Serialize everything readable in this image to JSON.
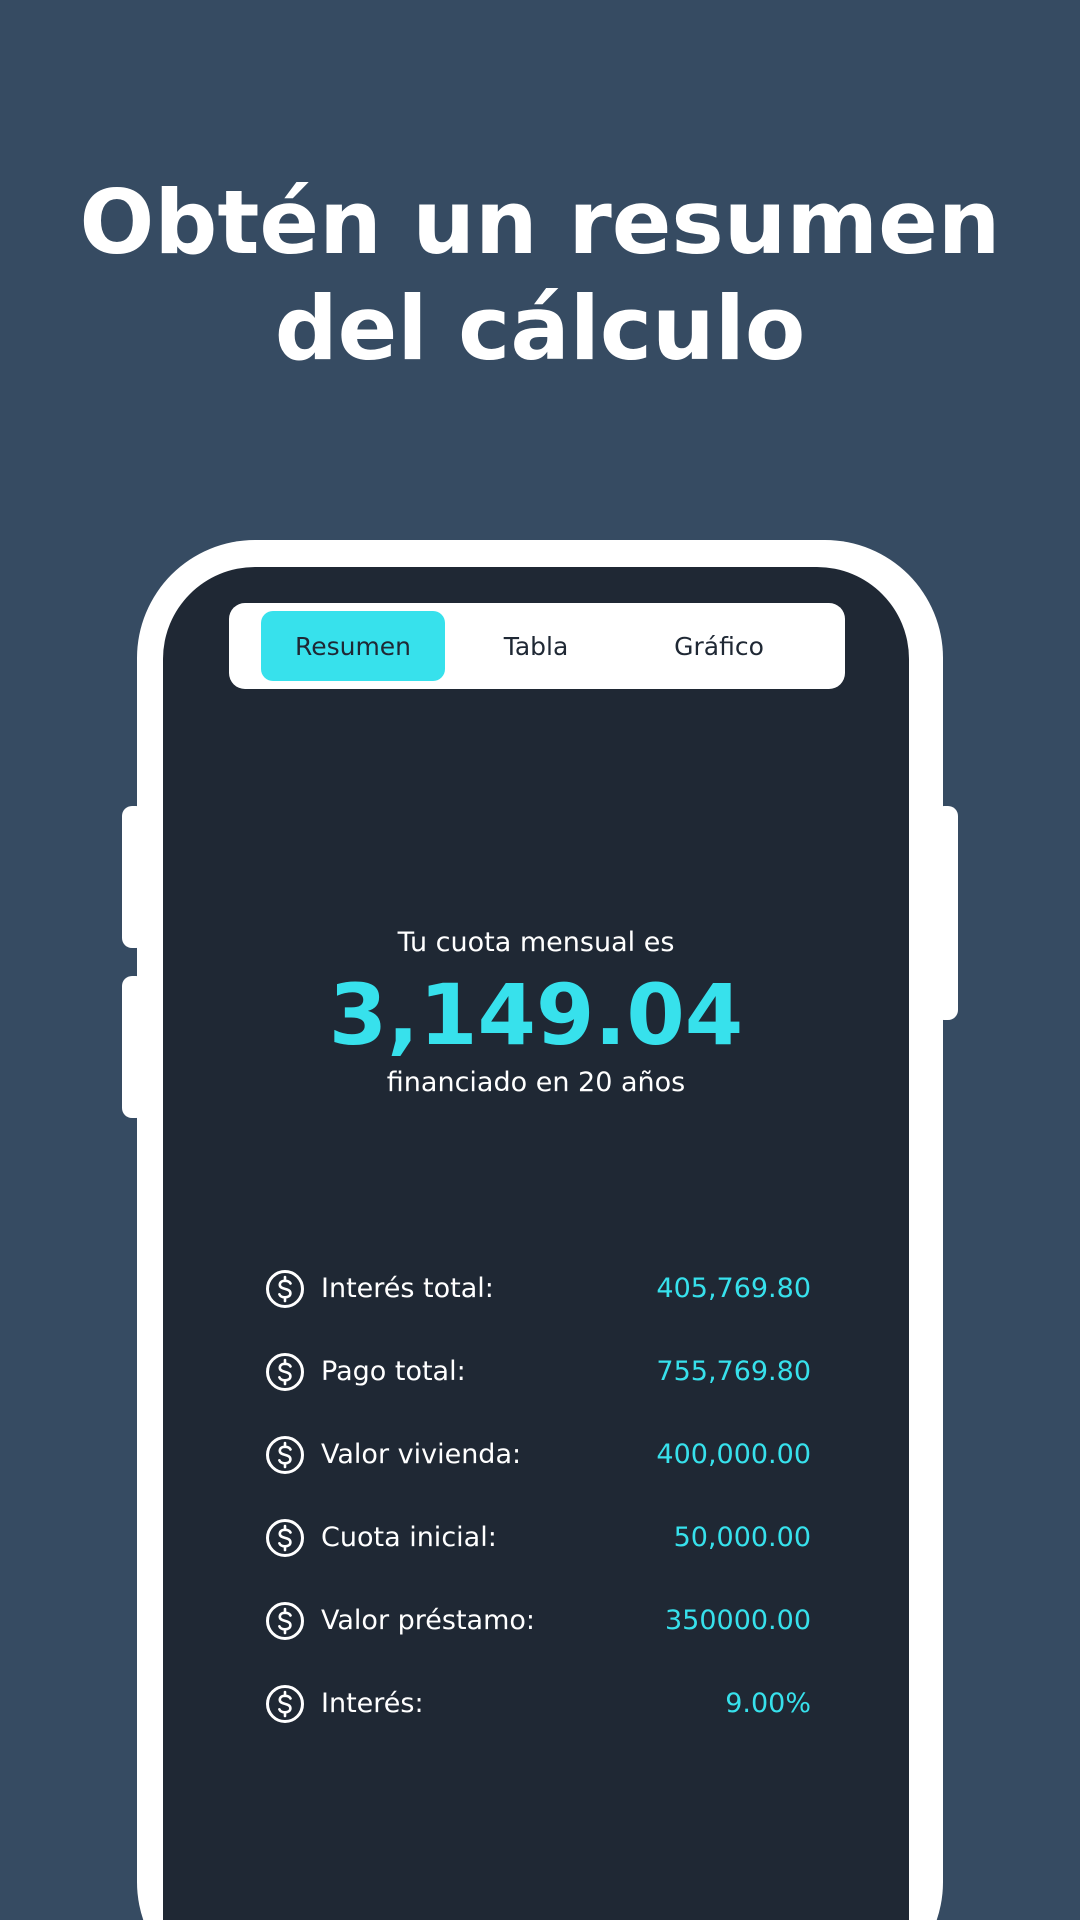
{
  "headline": {
    "line1": "Obtén un resumen",
    "line2": "del cálculo"
  },
  "tabs": [
    {
      "label": "Resumen",
      "active": true
    },
    {
      "label": "Tabla",
      "active": false
    },
    {
      "label": "Gráfico",
      "active": false
    }
  ],
  "summary": {
    "label": "Tu cuota mensual es",
    "amount": "3,149.04",
    "subtitle": "financiado en 20 años"
  },
  "rows": [
    {
      "icon": "dollar-circle-icon",
      "label": "Interés total:",
      "value": "405,769.80"
    },
    {
      "icon": "dollar-circle-icon",
      "label": "Pago total:",
      "value": "755,769.80"
    },
    {
      "icon": "dollar-circle-icon",
      "label": "Valor vivienda:",
      "value": "400,000.00"
    },
    {
      "icon": "dollar-circle-icon",
      "label": "Cuota inicial:",
      "value": "50,000.00"
    },
    {
      "icon": "dollar-circle-icon",
      "label": "Valor préstamo:",
      "value": "350000.00"
    },
    {
      "icon": "dollar-circle-icon",
      "label": "Interés:",
      "value": "9.00%"
    }
  ],
  "colors": {
    "background": "#364b62",
    "screen": "#1f2834",
    "accent": "#37e1ec",
    "text": "#ffffff"
  }
}
